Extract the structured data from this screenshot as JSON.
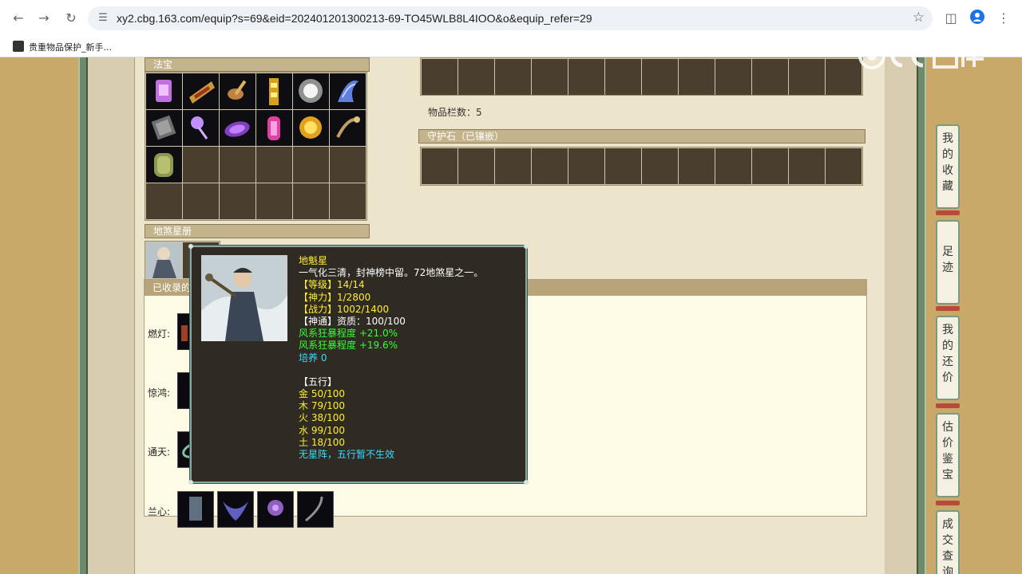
{
  "browser": {
    "url": "xy2.cbg.163.com/equip?s=69&eid=202401201300213-69-TO45WLB8L4IOO&o&equip_refer=29",
    "bookmark_label": "贵重物品保护_新手..."
  },
  "sections": {
    "fabao_title": "法宝",
    "disha_title": "地煞星册",
    "shouhu_title": "守护石（已镶嵌）",
    "item_count": "物品栏数：5",
    "collected_title": "已收录的"
  },
  "collected_rows": {
    "randeng": "燃灯:",
    "jinghong": "惊鸿:",
    "tongtian": "通天:",
    "lanxin": "兰心:"
  },
  "tooltip": {
    "name": "地魁星",
    "desc": "一气化三清，封神榜中留。72地煞星之一。",
    "level": "【等级】14/14",
    "shenli": "【神力】1/2800",
    "zhanli": "【战力】1002/1400",
    "shentong": "【神通】资质：100/100",
    "attr1": "风系狂暴程度 +21.0%",
    "attr2": "风系狂暴程度 +19.6%",
    "peiyang": "培养 0",
    "wuxing_title": "【五行】",
    "jin": "金 50/100",
    "mu": "木 79/100",
    "huo": "火 38/100",
    "shui": "水 99/100",
    "tu": "土 18/100",
    "note": "无星阵，五行暂不生效"
  },
  "side_tabs": {
    "favorites": [
      "我",
      "的",
      "收",
      "藏"
    ],
    "footprints": [
      "足",
      "迹"
    ],
    "counter_offer": [
      "我",
      "的",
      "还",
      "价"
    ],
    "appraisal": [
      "估",
      "价",
      "鉴",
      "宝"
    ],
    "deal_query": [
      "成",
      "交",
      "查",
      "询"
    ]
  },
  "colors": {
    "tooltip_yellow": "#ffee33",
    "tooltip_white": "#ffffff",
    "tooltip_green": "#33ff33",
    "tooltip_cyan": "#33ddff"
  }
}
